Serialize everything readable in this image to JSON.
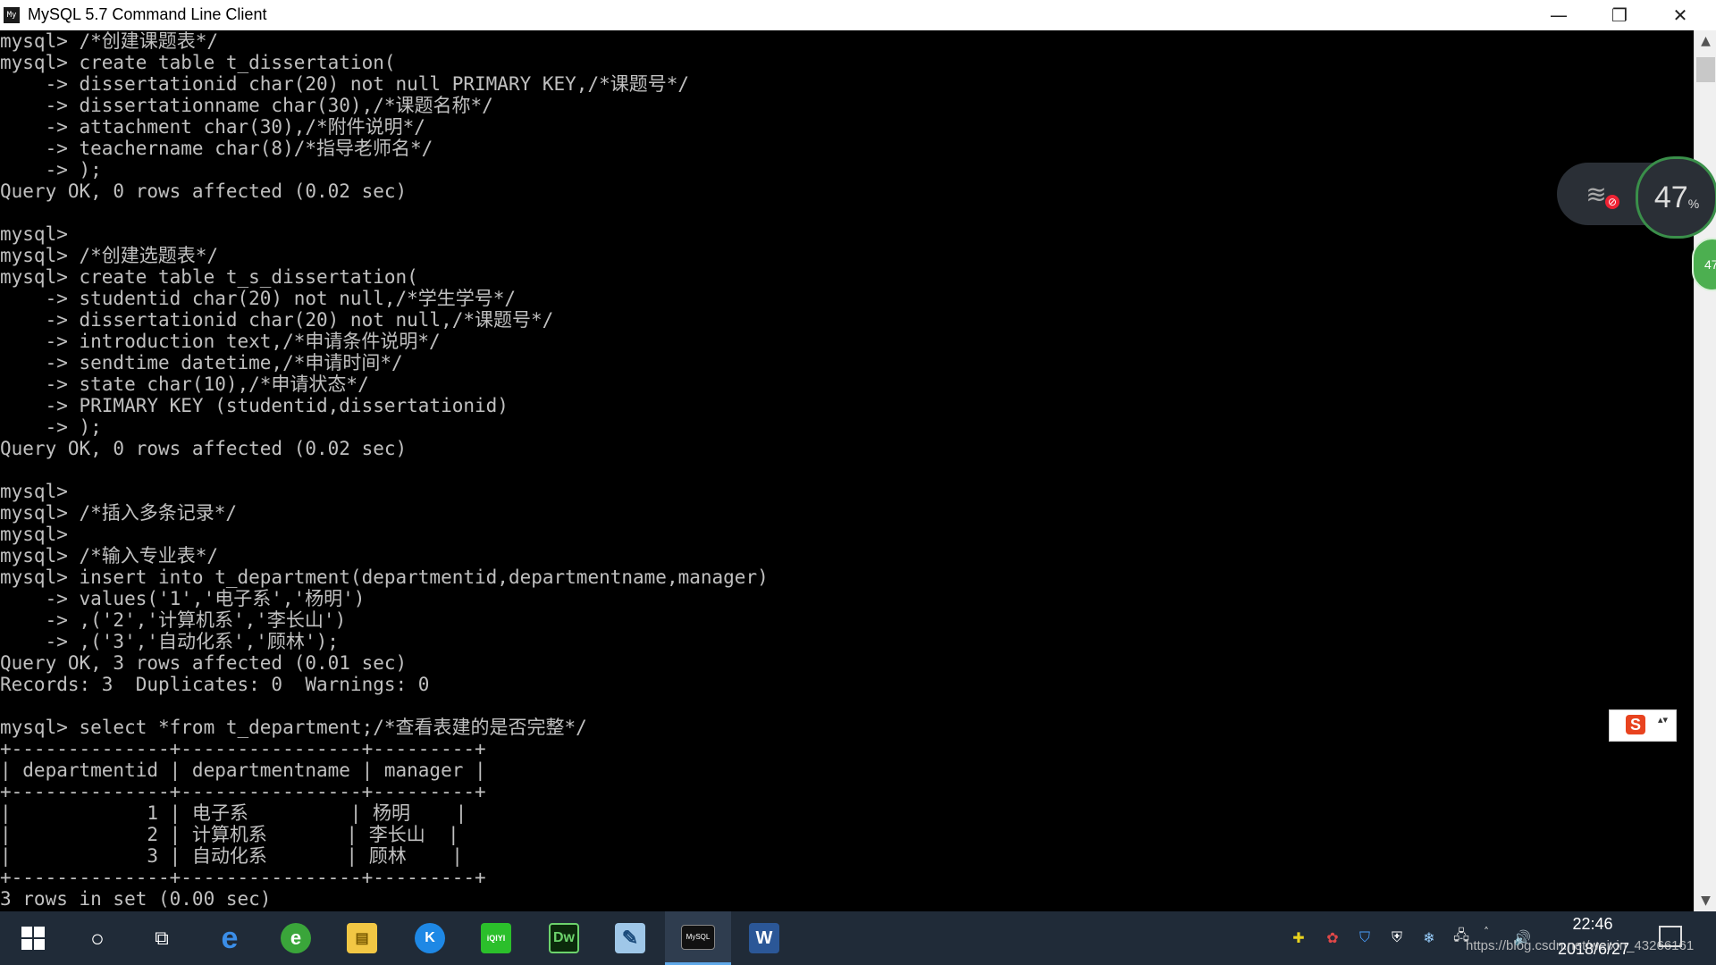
{
  "window": {
    "title": "MySQL 5.7 Command Line Client",
    "app_icon_text": "My",
    "minimize_glyph": "—",
    "maximize_glyph": "❐",
    "close_glyph": "✕"
  },
  "console": {
    "lines": [
      "mysql> /*创建课题表*/",
      "mysql> create table t_dissertation(",
      "    -> dissertationid char(20) not null PRIMARY KEY,/*课题号*/",
      "    -> dissertationname char(30),/*课题名称*/",
      "    -> attachment char(30),/*附件说明*/",
      "    -> teachername char(8)/*指导老师名*/",
      "    -> );",
      "Query OK, 0 rows affected (0.02 sec)",
      "",
      "mysql>",
      "mysql> /*创建选题表*/",
      "mysql> create table t_s_dissertation(",
      "    -> studentid char(20) not null,/*学生学号*/",
      "    -> dissertationid char(20) not null,/*课题号*/",
      "    -> introduction text,/*申请条件说明*/",
      "    -> sendtime datetime,/*申请时间*/",
      "    -> state char(10),/*申请状态*/",
      "    -> PRIMARY KEY (studentid,dissertationid)",
      "    -> );",
      "Query OK, 0 rows affected (0.02 sec)",
      "",
      "mysql>",
      "mysql> /*插入多条记录*/",
      "mysql>",
      "mysql> /*输入专业表*/",
      "mysql> insert into t_department(departmentid,departmentname,manager)",
      "    -> values('1','电子系','杨明')",
      "    -> ,('2','计算机系','李长山')",
      "    -> ,('3','自动化系','顾林');",
      "Query OK, 3 rows affected (0.01 sec)",
      "Records: 3  Duplicates: 0  Warnings: 0",
      "",
      "mysql> select *from t_department;/*查看表建的是否完整*/",
      "+--------------+----------------+---------+",
      "| departmentid | departmentname | manager |",
      "+--------------+----------------+---------+",
      "|            1 | 电子系         | 杨明    |",
      "|            2 | 计算机系       | 李长山  |",
      "|            3 | 自动化系       | 顾林    |",
      "+--------------+----------------+---------+",
      "3 rows in set (0.00 sec)"
    ]
  },
  "scrollbar": {
    "up_glyph": "▲",
    "down_glyph": "▼"
  },
  "overlay": {
    "network_percent": "47",
    "percent_sign": "%",
    "wifi_glyph": "≋",
    "blocked_glyph": "⊘",
    "side_badge": "47",
    "ime_logo": "S",
    "ime_menu": "▴▾"
  },
  "taskbar": {
    "apps": [
      {
        "name": "start",
        "label": ""
      },
      {
        "name": "search",
        "label": "○"
      },
      {
        "name": "task-view",
        "label": "⧉"
      },
      {
        "name": "edge",
        "label": "e"
      },
      {
        "name": "browser-360",
        "label": "e"
      },
      {
        "name": "file-explorer",
        "label": "▤"
      },
      {
        "name": "kugou",
        "label": "K"
      },
      {
        "name": "iqiyi",
        "label": "iQIYI"
      },
      {
        "name": "dreamweaver",
        "label": "Dw"
      },
      {
        "name": "notes",
        "label": "✎"
      },
      {
        "name": "mysql-console",
        "label": "MySQL"
      },
      {
        "name": "word",
        "label": "W"
      }
    ],
    "tray": [
      "✚",
      "✿",
      "⛉",
      "⛨",
      "❄",
      "🖧",
      "˄",
      "🔊"
    ],
    "time": "22:46",
    "date": "2018/6/27",
    "watermark": "https://blog.csdn.net/weixin_43266161"
  },
  "colors": {
    "console_bg": "#000000",
    "console_text": "#c0c0c0",
    "taskbar_bg": "#202b38",
    "accent": "#5fa8e8"
  }
}
